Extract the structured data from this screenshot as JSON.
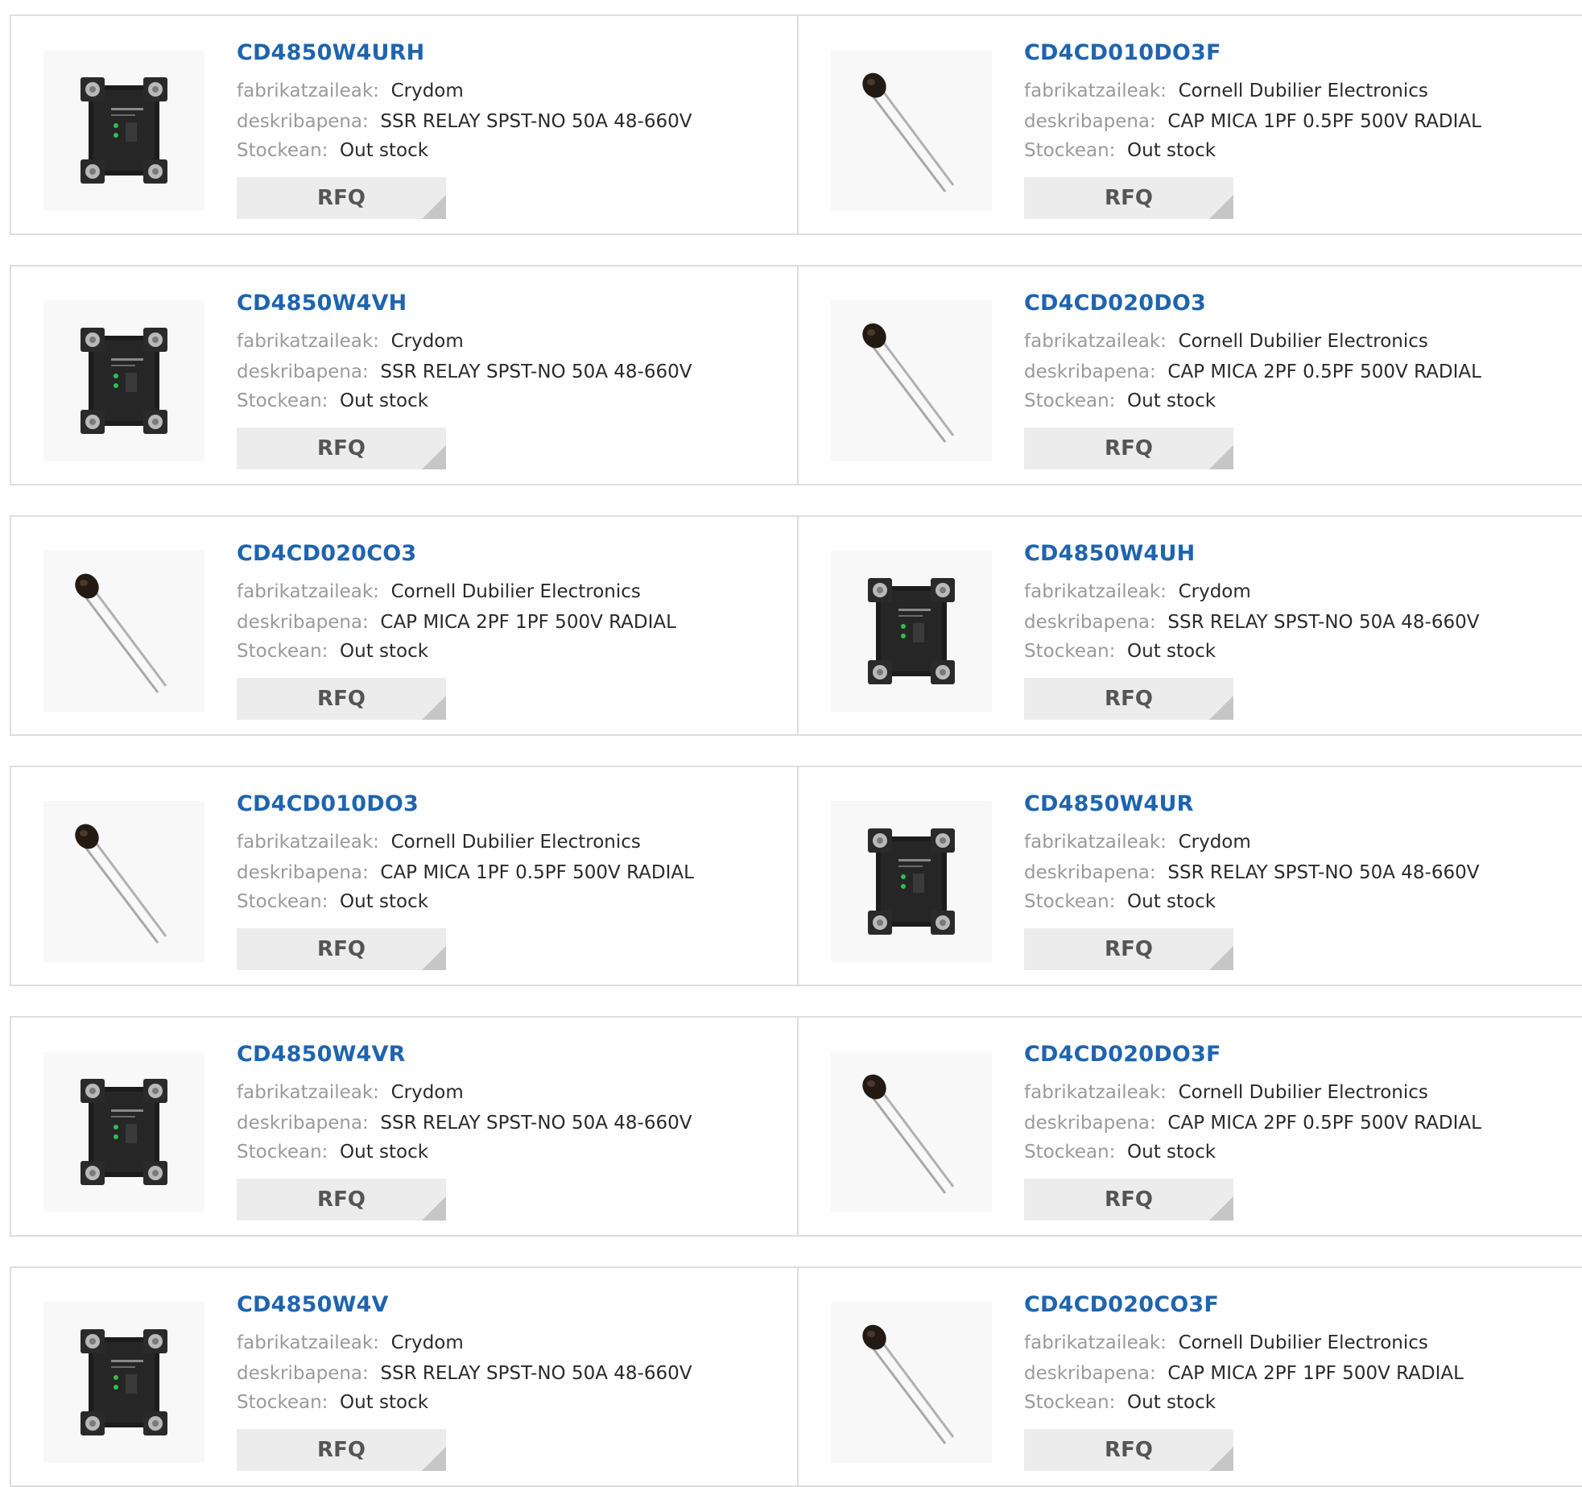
{
  "labels": {
    "manufacturer": "fabrikatzaileak:",
    "description": "deskribapena:",
    "stock": "Stockean:",
    "rfq": "RFQ"
  },
  "products": [
    {
      "part": "CD4850W4URH",
      "manufacturer": "Crydom",
      "description": "SSR RELAY SPST-NO 50A 48-660V",
      "stock": "Out stock",
      "icon": "relay"
    },
    {
      "part": "CD4CD010DO3F",
      "manufacturer": "Cornell Dubilier Electronics",
      "description": "CAP MICA 1PF 0.5PF 500V RADIAL",
      "stock": "Out stock",
      "icon": "capacitor"
    },
    {
      "part": "CD4850W4VH",
      "manufacturer": "Crydom",
      "description": "SSR RELAY SPST-NO 50A 48-660V",
      "stock": "Out stock",
      "icon": "relay"
    },
    {
      "part": "CD4CD020DO3",
      "manufacturer": "Cornell Dubilier Electronics",
      "description": "CAP MICA 2PF 0.5PF 500V RADIAL",
      "stock": "Out stock",
      "icon": "capacitor"
    },
    {
      "part": "CD4CD020CO3",
      "manufacturer": "Cornell Dubilier Electronics",
      "description": "CAP MICA 2PF 1PF 500V RADIAL",
      "stock": "Out stock",
      "icon": "capacitor"
    },
    {
      "part": "CD4850W4UH",
      "manufacturer": "Crydom",
      "description": "SSR RELAY SPST-NO 50A 48-660V",
      "stock": "Out stock",
      "icon": "relay"
    },
    {
      "part": "CD4CD010DO3",
      "manufacturer": "Cornell Dubilier Electronics",
      "description": "CAP MICA 1PF 0.5PF 500V RADIAL",
      "stock": "Out stock",
      "icon": "capacitor"
    },
    {
      "part": "CD4850W4UR",
      "manufacturer": "Crydom",
      "description": "SSR RELAY SPST-NO 50A 48-660V",
      "stock": "Out stock",
      "icon": "relay"
    },
    {
      "part": "CD4850W4VR",
      "manufacturer": "Crydom",
      "description": "SSR RELAY SPST-NO 50A 48-660V",
      "stock": "Out stock",
      "icon": "relay"
    },
    {
      "part": "CD4CD020DO3F",
      "manufacturer": "Cornell Dubilier Electronics",
      "description": "CAP MICA 2PF 0.5PF 500V RADIAL",
      "stock": "Out stock",
      "icon": "capacitor"
    },
    {
      "part": "CD4850W4V",
      "manufacturer": "Crydom",
      "description": "SSR RELAY SPST-NO 50A 48-660V",
      "stock": "Out stock",
      "icon": "relay"
    },
    {
      "part": "CD4CD020CO3F",
      "manufacturer": "Cornell Dubilier Electronics",
      "description": "CAP MICA 2PF 1PF 500V RADIAL",
      "stock": "Out stock",
      "icon": "capacitor"
    }
  ],
  "colors": {
    "link": "#1f64ae",
    "label": "#9a9a9a",
    "value": "#2a2a2a",
    "border": "#dedede",
    "button": "#ececec"
  }
}
